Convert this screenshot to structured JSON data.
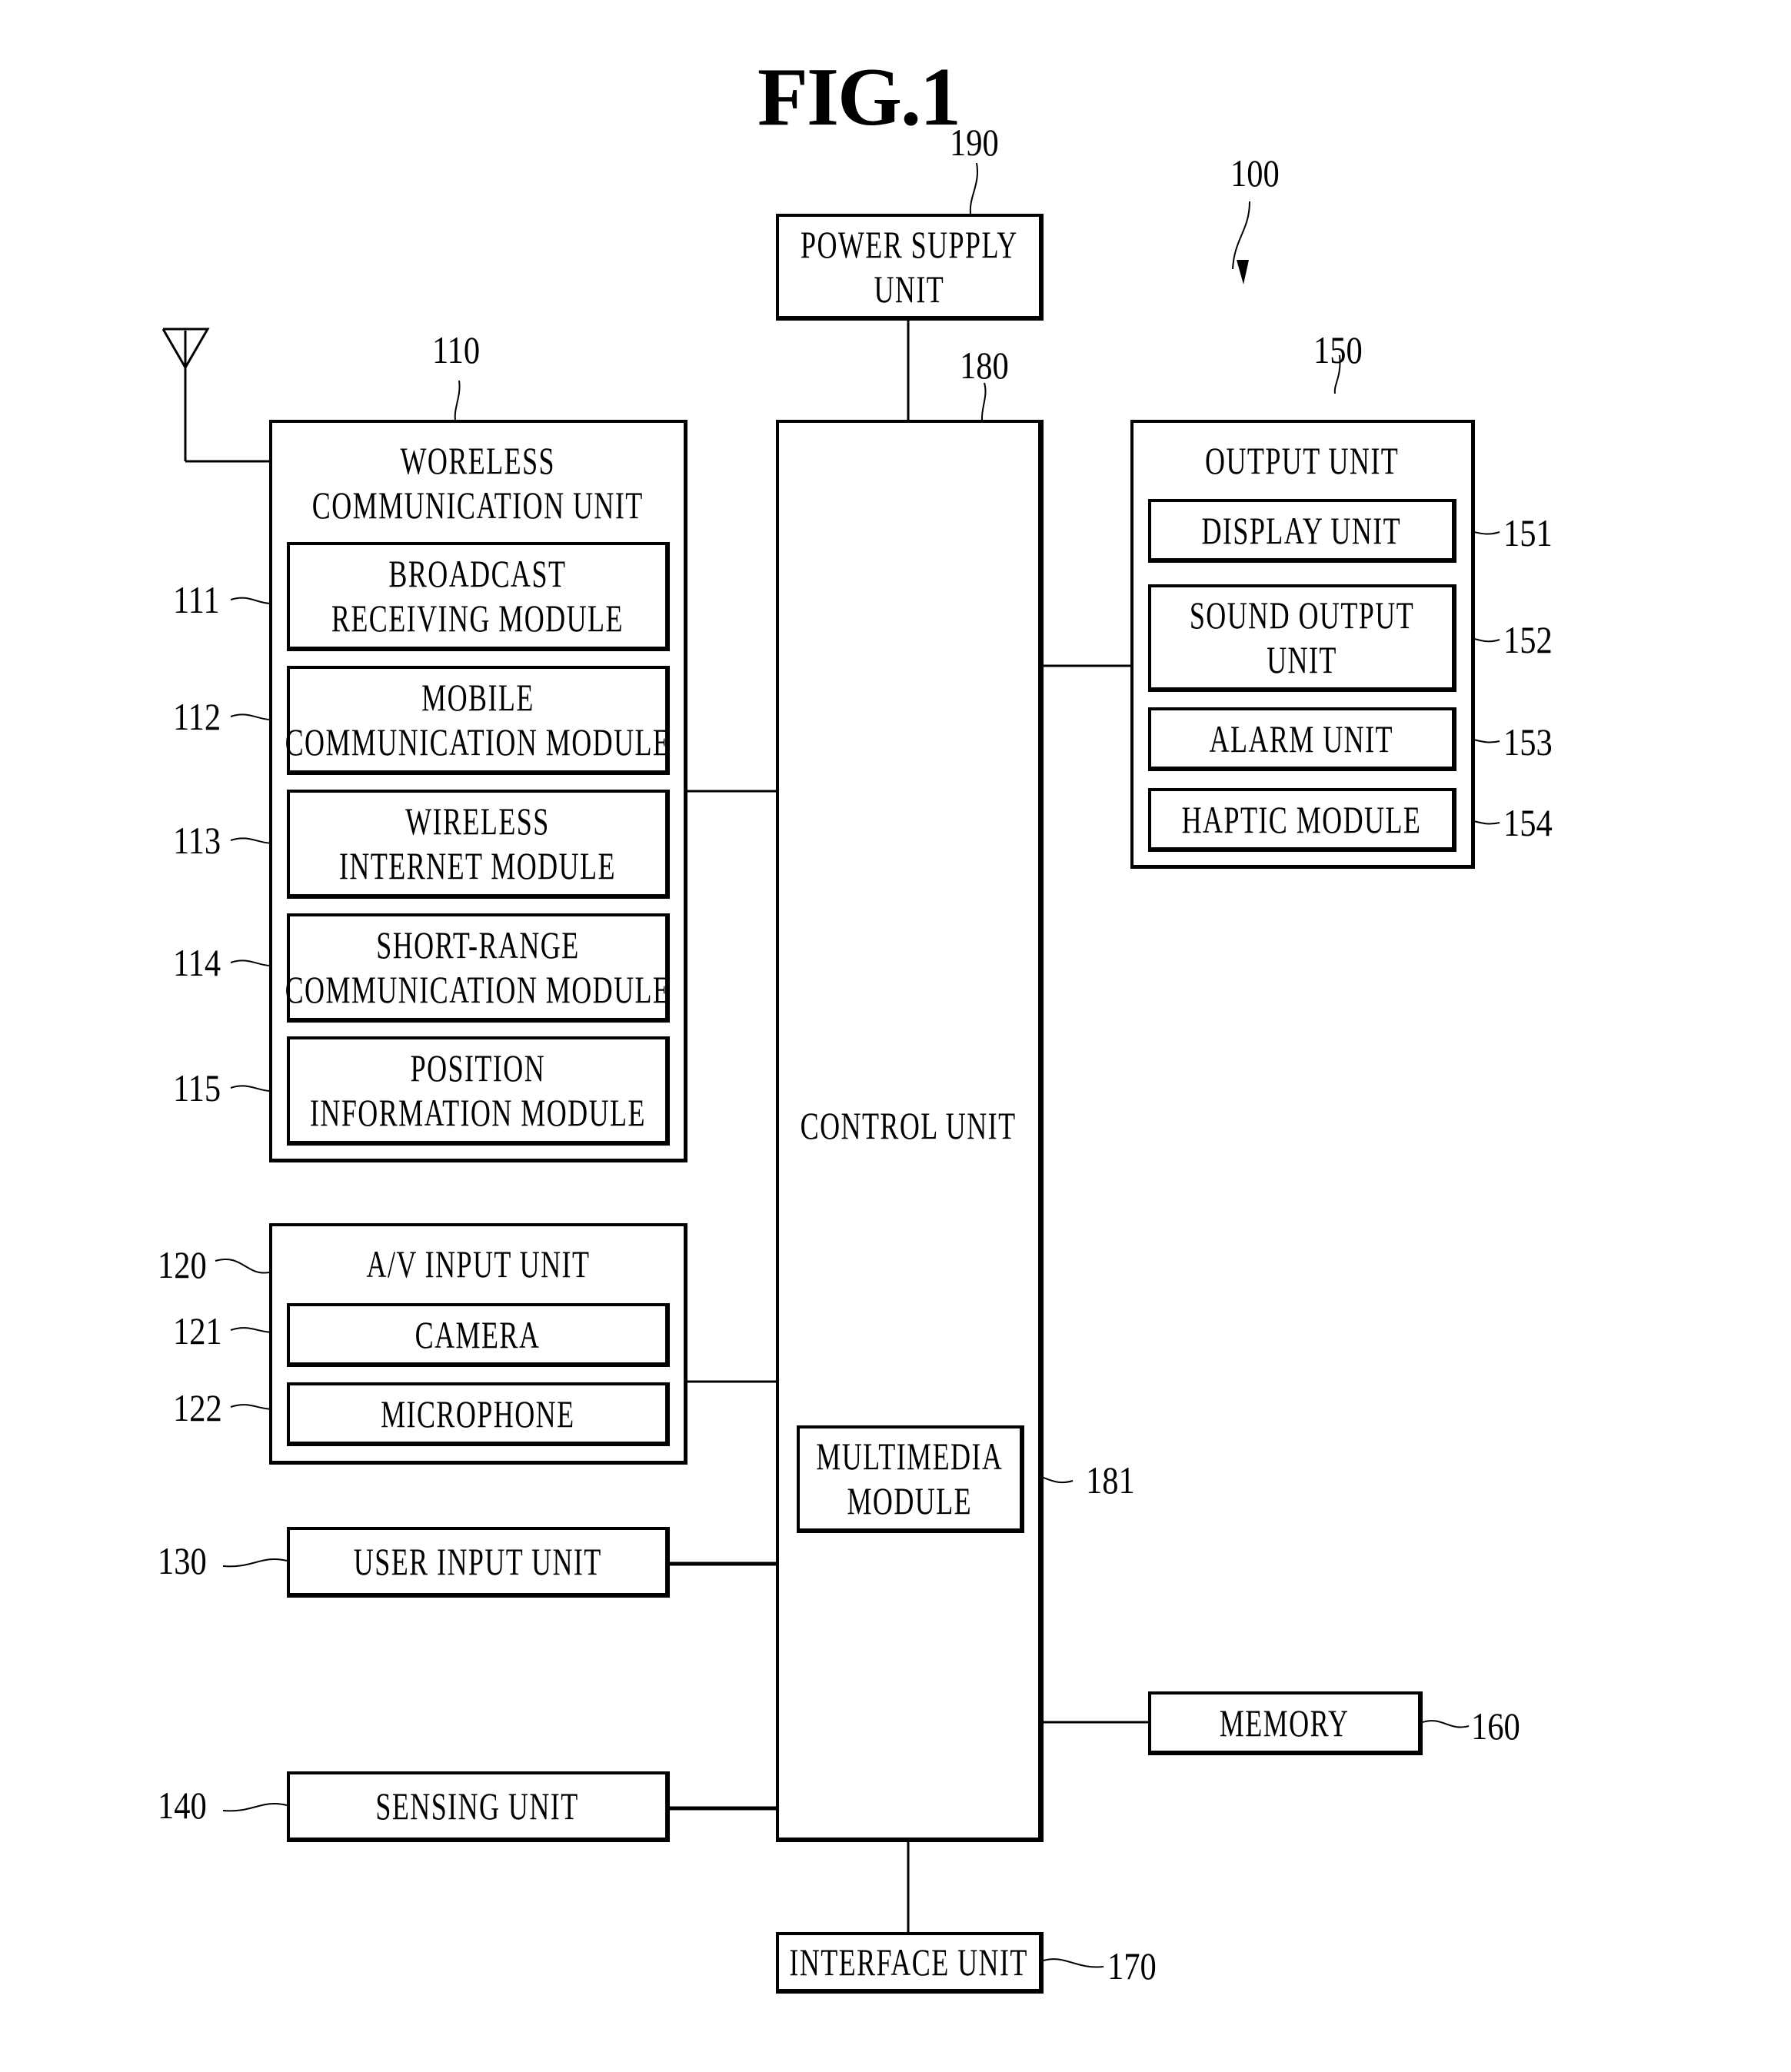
{
  "figure": {
    "title": "FIG.1",
    "device_ref": "100"
  },
  "power_supply": {
    "ref": "190",
    "label": "POWER SUPPLY\nUNIT"
  },
  "control_unit": {
    "ref": "180",
    "label": "CONTROL UNIT",
    "multimedia_module": {
      "ref": "181",
      "label": "MULTIMEDIA\nMODULE"
    }
  },
  "wireless_unit": {
    "ref": "110",
    "label": "WORELESS\nCOMMUNICATION UNIT",
    "modules": [
      {
        "ref": "111",
        "label": "BROADCAST\nRECEIVING MODULE"
      },
      {
        "ref": "112",
        "label": "MOBILE\nCOMMUNICATION MODULE"
      },
      {
        "ref": "113",
        "label": "WIRELESS\nINTERNET MODULE"
      },
      {
        "ref": "114",
        "label": "SHORT-RANGE\nCOMMUNICATION MODULE"
      },
      {
        "ref": "115",
        "label": "POSITION\nINFORMATION MODULE"
      }
    ]
  },
  "av_input_unit": {
    "ref": "120",
    "label": "A/V INPUT UNIT",
    "modules": [
      {
        "ref": "121",
        "label": "CAMERA"
      },
      {
        "ref": "122",
        "label": "MICROPHONE"
      }
    ]
  },
  "user_input_unit": {
    "ref": "130",
    "label": "USER INPUT UNIT"
  },
  "sensing_unit": {
    "ref": "140",
    "label": "SENSING UNIT"
  },
  "output_unit": {
    "ref": "150",
    "label": "OUTPUT UNIT",
    "modules": [
      {
        "ref": "151",
        "label": "DISPLAY UNIT"
      },
      {
        "ref": "152",
        "label": "SOUND OUTPUT\nUNIT"
      },
      {
        "ref": "153",
        "label": "ALARM UNIT"
      },
      {
        "ref": "154",
        "label": "HAPTIC MODULE"
      }
    ]
  },
  "memory": {
    "ref": "160",
    "label": "MEMORY"
  },
  "interface_unit": {
    "ref": "170",
    "label": "INTERFACE UNIT"
  }
}
